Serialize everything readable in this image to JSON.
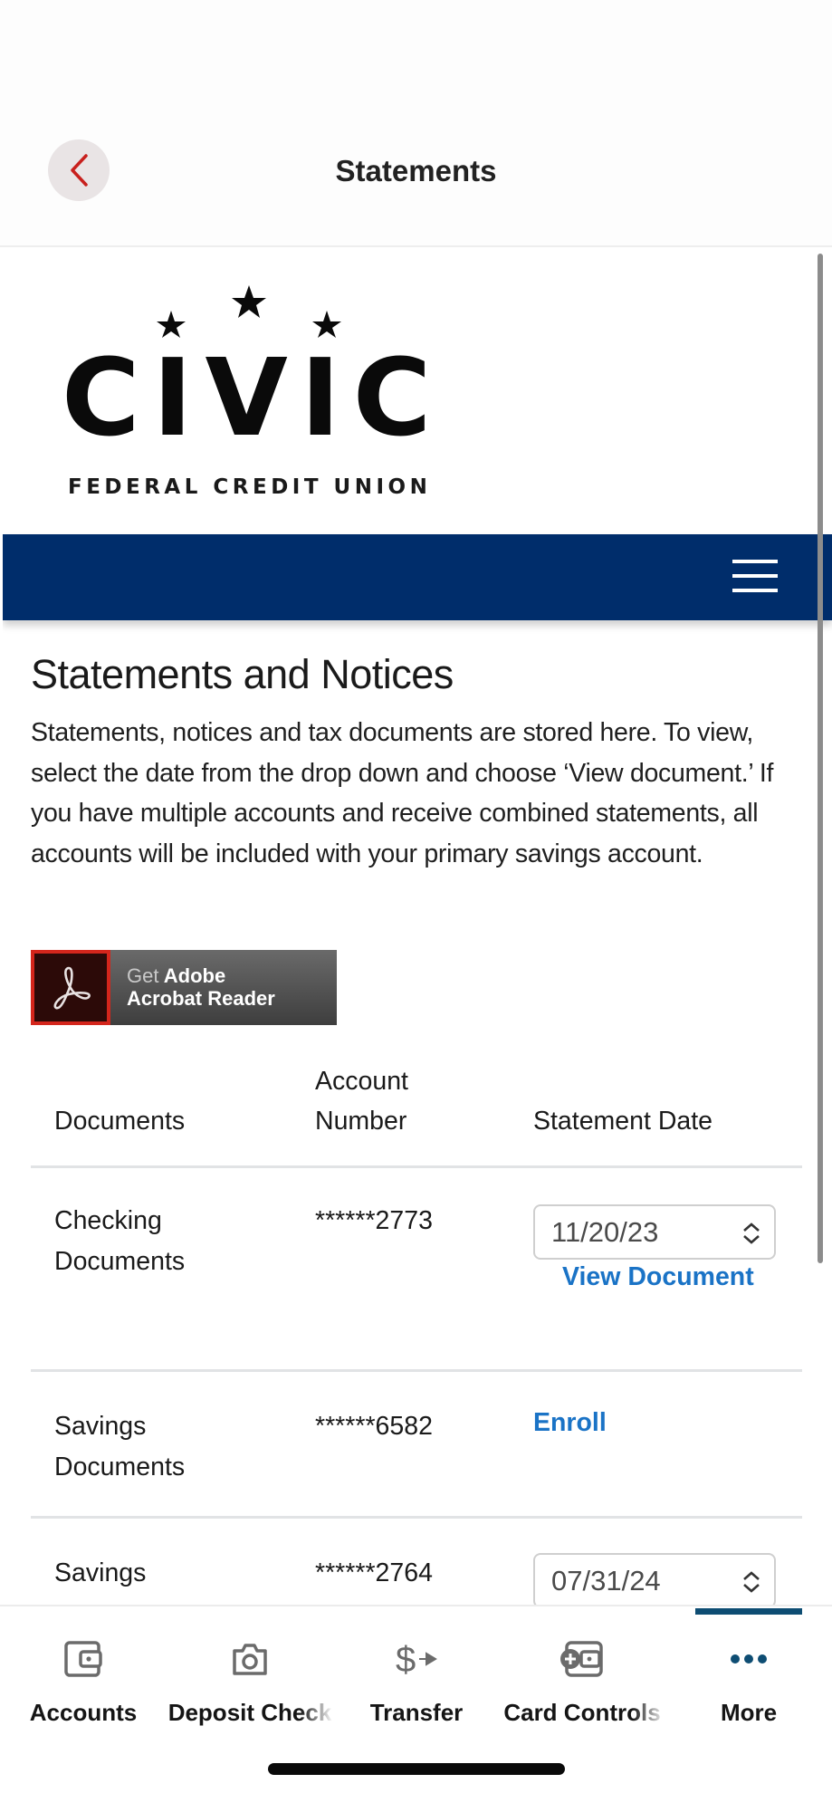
{
  "header": {
    "title": "Statements",
    "back_icon": "chevron-left-icon"
  },
  "brand": {
    "logo_word": "CIVIC",
    "logo_subtitle": "FEDERAL CREDIT UNION",
    "nav_color": "#002d6b",
    "menu_icon": "hamburger-menu-icon"
  },
  "content": {
    "heading": "Statements and Notices",
    "intro": "Statements, notices and tax documents are stored here. To view, select the date from the drop down and choose ‘View document.’ If you have multiple accounts and receive combined statements, all accounts will be included with your primary savings account.",
    "adobe_badge": {
      "get": "Get",
      "line1": "Adobe",
      "line2": "Acrobat Reader"
    }
  },
  "table": {
    "headers": {
      "documents": "Documents",
      "account_number": "Account Number",
      "statement_date": "Statement Date"
    },
    "rows": [
      {
        "document": "Checking Documents",
        "account": "******2773",
        "date_selected": "11/20/23",
        "action": "View Document"
      },
      {
        "document": "Savings Documents",
        "account": "******6582",
        "action": "Enroll"
      },
      {
        "document": "Savings",
        "account": "******2764",
        "date_selected": "07/31/24"
      }
    ],
    "link_color": "#1a73c6"
  },
  "tabbar": {
    "active_index": 4,
    "active_color": "#0e4d73",
    "tabs": [
      {
        "label": "Accounts",
        "icon": "wallet-icon"
      },
      {
        "label": "Deposit Check",
        "icon": "camera-icon"
      },
      {
        "label": "Transfer",
        "icon": "dollar-transfer-icon"
      },
      {
        "label": "Card Controls",
        "icon": "card-control-icon"
      },
      {
        "label": "More",
        "icon": "more-dots-icon"
      }
    ]
  }
}
